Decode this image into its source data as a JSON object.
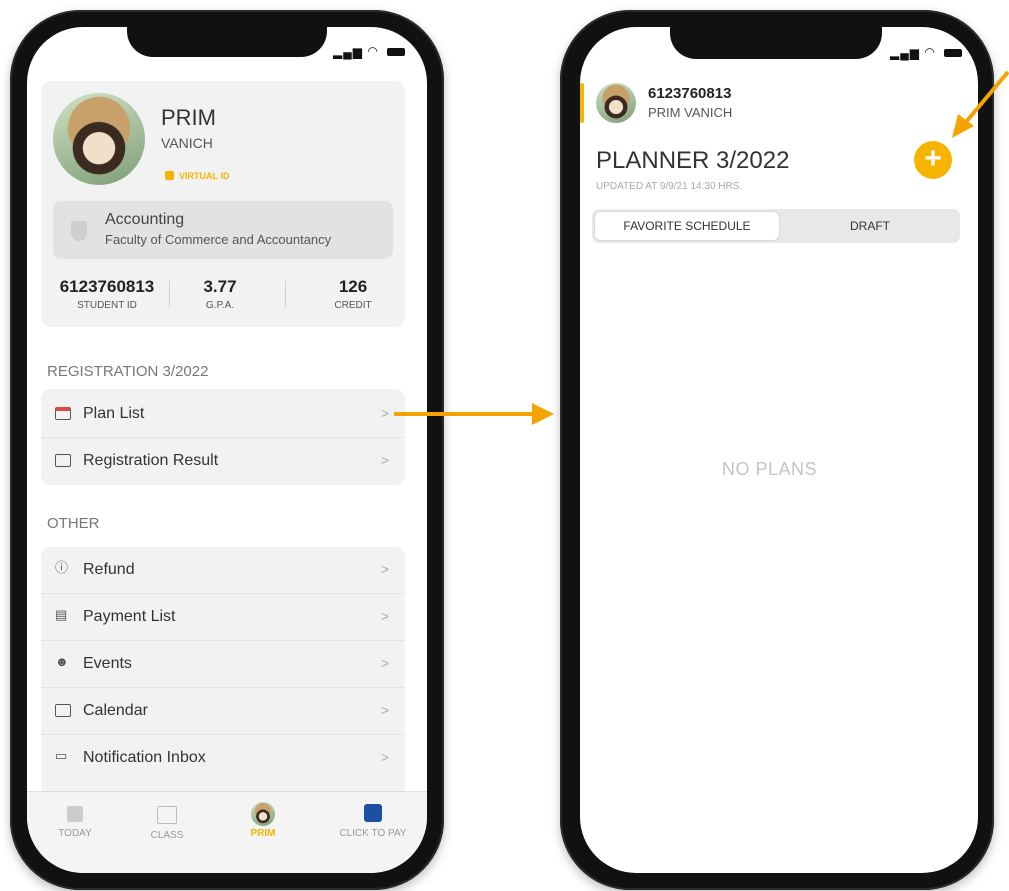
{
  "left_phone": {
    "profile": {
      "first_name": "PRIM",
      "last_name": "VANICH",
      "virtual_id_label": "VIRTUAL ID",
      "major": "Accounting",
      "faculty": "Faculty of Commerce and Accountancy",
      "stats": [
        {
          "value": "6123760813",
          "label": "STUDENT ID"
        },
        {
          "value": "3.77",
          "label": "G.P.A."
        },
        {
          "value": "126",
          "label": "CREDIT"
        }
      ]
    },
    "registration_section": "REGISTRATION 3/2022",
    "registration_items": [
      {
        "label": "Plan List",
        "icon": "calendar-red-icon"
      },
      {
        "label": "Registration Result",
        "icon": "card-icon"
      }
    ],
    "other_section": "OTHER",
    "other_items": [
      {
        "label": "Refund",
        "icon": "info-icon"
      },
      {
        "label": "Payment List",
        "icon": "receipt-icon"
      },
      {
        "label": "Events",
        "icon": "masks-icon"
      },
      {
        "label": "Calendar",
        "icon": "card-icon"
      },
      {
        "label": "Notification Inbox",
        "icon": "inbox-icon"
      }
    ],
    "tabs": [
      {
        "label": "TODAY",
        "icon": "books-icon"
      },
      {
        "label": "CLASS",
        "icon": "chart-icon"
      },
      {
        "label": "PRIM",
        "icon": "avatar-icon"
      },
      {
        "label": "CLICK TO PAY",
        "icon": "pay-icon"
      }
    ]
  },
  "right_phone": {
    "student_id": "6123760813",
    "student_name": "PRIM VANICH",
    "title": "PLANNER 3/2022",
    "updated": "UPDATED AT 9/9/21 14:30 HRS.",
    "add_label": "+",
    "segments": [
      "FAVORITE SCHEDULE",
      "DRAFT"
    ],
    "empty_text": "NO PLANS"
  },
  "colors": {
    "accent": "#f5b400",
    "arrow": "#f5a300"
  }
}
